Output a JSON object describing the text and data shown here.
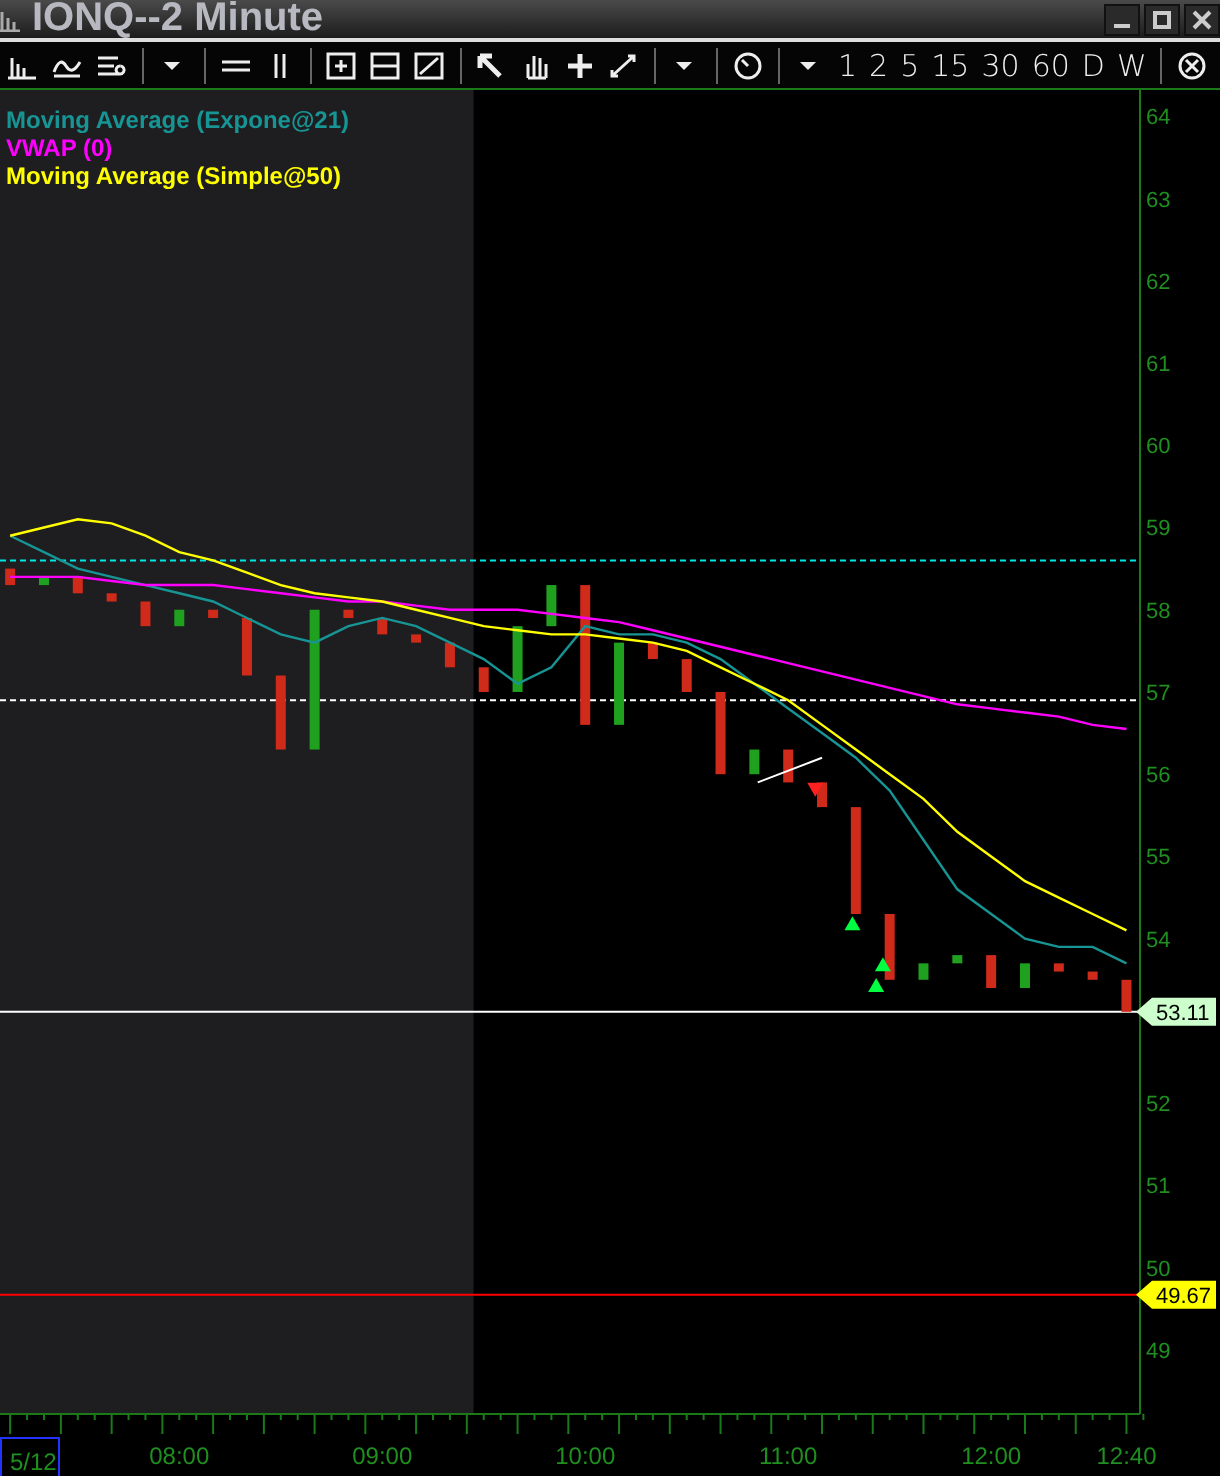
{
  "window": {
    "title": "IONQ--2 Minute"
  },
  "toolbar": {
    "intervals": [
      "1",
      "2",
      "5",
      "15",
      "30",
      "60",
      "D",
      "W"
    ]
  },
  "chart": {
    "date_label": "5/12",
    "chart_data": {
      "type": "line",
      "categories": [
        null,
        null,
        null,
        null,
        null,
        "08:00",
        null,
        null,
        null,
        null,
        null,
        "09:00",
        null,
        null,
        null,
        null,
        null,
        "10:00",
        null,
        null,
        null,
        null,
        null,
        "11:00",
        null,
        null,
        null,
        null,
        null,
        "12:00",
        null,
        null,
        null,
        "12:40"
      ],
      "series": [
        {
          "name": "Moving Average (Expone@21)",
          "color": "#179494",
          "values": [
            58.9,
            58.7,
            58.5,
            58.4,
            58.3,
            58.2,
            58.1,
            57.9,
            57.7,
            57.6,
            57.8,
            57.9,
            57.8,
            57.6,
            57.4,
            57.1,
            57.3,
            57.8,
            57.7,
            57.7,
            57.6,
            57.4,
            57.1,
            56.8,
            56.5,
            56.2,
            55.8,
            55.2,
            54.6,
            54.3,
            54.0,
            53.9,
            53.9,
            53.7
          ]
        },
        {
          "name": "VWAP (0)",
          "color": "#ff00ff",
          "values": [
            58.4,
            58.4,
            58.4,
            58.35,
            58.3,
            58.3,
            58.3,
            58.25,
            58.2,
            58.15,
            58.1,
            58.1,
            58.05,
            58.0,
            58.0,
            58.0,
            57.95,
            57.9,
            57.85,
            57.75,
            57.65,
            57.55,
            57.45,
            57.35,
            57.25,
            57.15,
            57.05,
            56.95,
            56.85,
            56.8,
            56.75,
            56.7,
            56.6,
            56.55
          ]
        },
        {
          "name": "Moving Average (Simple@50)",
          "color": "#ffff00",
          "values": [
            58.9,
            59.0,
            59.1,
            59.05,
            58.9,
            58.7,
            58.6,
            58.45,
            58.3,
            58.2,
            58.15,
            58.1,
            58.0,
            57.9,
            57.8,
            57.75,
            57.7,
            57.7,
            57.65,
            57.6,
            57.5,
            57.3,
            57.1,
            56.9,
            56.6,
            56.3,
            56.0,
            55.7,
            55.3,
            55.0,
            54.7,
            54.5,
            54.3,
            54.1
          ]
        }
      ],
      "ylim": [
        48.22,
        64.32
      ],
      "yticks": [
        49,
        50,
        51,
        52,
        54,
        55,
        56,
        57,
        58,
        59,
        60,
        61,
        62,
        63,
        64
      ]
    },
    "price_tags": [
      {
        "kind": "last",
        "label": "53.11"
      },
      {
        "kind": "alert",
        "label": "49.67"
      }
    ]
  }
}
